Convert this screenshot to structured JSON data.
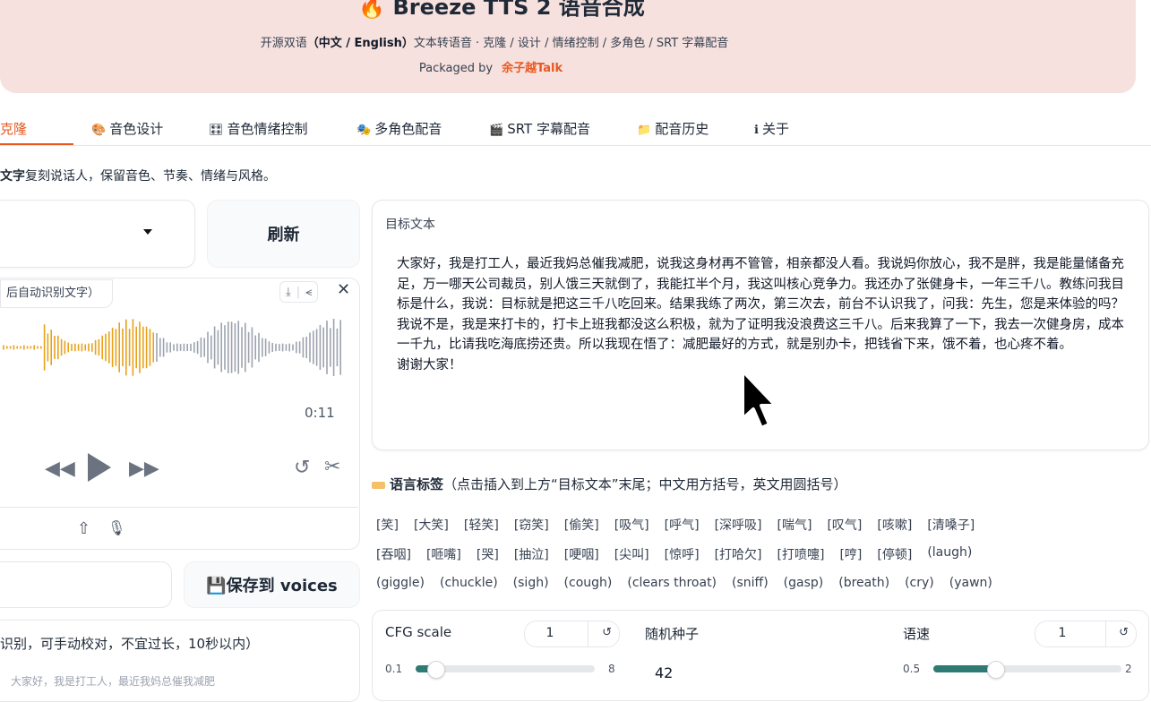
{
  "header": {
    "fire_emoji": "🔥",
    "title": "Breeze TTS 2 语音合成",
    "subtitle_pre": "开源双语",
    "subtitle_bold": "（中文 / English）",
    "subtitle_post": "文本转语音 · 克隆 / 设计 / 情绪控制 / 多角色 / SRT 字幕配音",
    "packaged_by": "Packaged by",
    "author": "余子越Talk"
  },
  "tabs": [
    {
      "icon": "",
      "label": "音色克隆",
      "active": true
    },
    {
      "icon": "🎨",
      "label": "音色设计"
    },
    {
      "icon": "🎛",
      "label": "音色情绪控制"
    },
    {
      "icon": "🎭",
      "label": "多角色配音"
    },
    {
      "icon": "🎬",
      "label": "SRT 字幕配音"
    },
    {
      "icon": "📁",
      "label": "配音历史"
    },
    {
      "icon": "ℹ",
      "label": "关于"
    }
  ],
  "description": {
    "bold": "文字",
    "rest": "复刻说话人，保留音色、节奏、情绪与风格。"
  },
  "left": {
    "refresh_label": "刷新",
    "audio_label": "后自动识别文字）",
    "duration": "0:11",
    "save_label": "💾保存到 voices",
    "ref_text_label": "识别，可手动校对，不宜过长，10秒以内）",
    "ref_text_hint": "大家好，我是打工人，最近我妈总催我减肥"
  },
  "target": {
    "label": "目标文本",
    "text": "大家好，我是打工人，最近我妈总催我减肥，说我这身材再不管管，相亲都没人看。我说妈你放心，我不是胖，我是能量储备充足，万一哪天公司裁员，别人饿三天就倒了，我能扛半个月，我这叫核心竞争力。我还办了张健身卡，一年三千八。教练问我目标是什么，我说：目标就是把这三千八吃回来。结果我练了两次，第三次去，前台不认识我了，问我：先生，您是来体验的吗？\n我说不是，我是来打卡的，打卡上班我都没这么积极，就为了证明我没浪费这三千八。后来我算了一下，我去一次健身房，成本一千九，比请我吃海底捞还贵。所以我现在悟了：减肥最好的方式，就是别办卡，把钱省下来，饿不着，也心疼不着。\n谢谢大家！"
  },
  "tags": {
    "title_bold": "语言标签",
    "title_rest": "（点击插入到上方“目标文本”末尾；中文用方括号，英文用圆括号）",
    "row1": [
      "[笑]",
      "[大笑]",
      "[轻笑]",
      "[窃笑]",
      "[偷笑]",
      "[吸气]",
      "[呼气]",
      "[深呼吸]",
      "[喘气]",
      "[叹气]",
      "[咳嗽]",
      "[清嗓子]"
    ],
    "row2": [
      "[吞咽]",
      "[咂嘴]",
      "[哭]",
      "[抽泣]",
      "[哽咽]",
      "[尖叫]",
      "[惊呼]",
      "[打哈欠]",
      "[打喷嚏]",
      "[哼]",
      "[停顿]",
      "(laugh)"
    ],
    "row3": [
      "(giggle)",
      "(chuckle)",
      "(sigh)",
      "(cough)",
      "(clears throat)",
      "(sniff)",
      "(gasp)",
      "(breath)",
      "(cry)",
      "(yawn)"
    ]
  },
  "params": {
    "cfg_label": "CFG scale",
    "cfg_value": "1",
    "cfg_min": "0.1",
    "cfg_max": "8",
    "cfg_fraction": 0.11,
    "seed_label": "随机种子",
    "seed_value": "42",
    "speed_label": "语速",
    "speed_value": "1",
    "speed_min": "0.5",
    "speed_max": "2",
    "speed_fraction": 0.33,
    "reset_icon": "↺"
  },
  "colors": {
    "accent": "#e8581f",
    "header_bg": "#f6e1de",
    "slider": "#2f7a73",
    "wave_played": "#e8a21a",
    "wave_rest": "#9ca3af"
  }
}
